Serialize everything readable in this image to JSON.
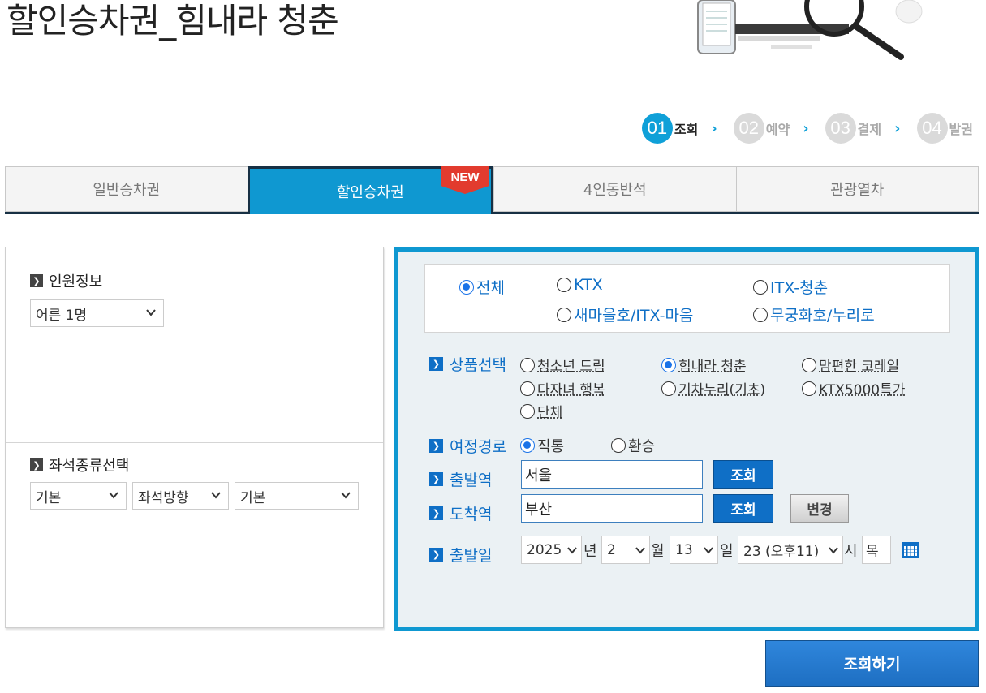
{
  "page": {
    "title": "할인승차권_힘내라 청춘"
  },
  "steps": [
    {
      "num": "01",
      "label": "조회",
      "active": true
    },
    {
      "num": "02",
      "label": "예약",
      "active": false
    },
    {
      "num": "03",
      "label": "결제",
      "active": false
    },
    {
      "num": "04",
      "label": "발권",
      "active": false
    }
  ],
  "tabs": {
    "general": "일반승차권",
    "discount": "할인승차권",
    "discount_badge": "NEW",
    "four_seat": "4인동반석",
    "tourist": "관광열차"
  },
  "left": {
    "passenger_title": "인원정보",
    "passenger_value": "어른 1명",
    "seat_title": "좌석종류선택",
    "seat_type": "기본",
    "seat_direction": "좌석방향",
    "seat_position": "기본"
  },
  "train_types": {
    "all": "전체",
    "ktx": "KTX",
    "itx_cheongchun": "ITX-청춘",
    "saemaeul": "새마을호/ITX-마음",
    "mugunghwa": "무궁화호/누리로",
    "selected": "전체"
  },
  "product": {
    "label": "상품선택",
    "options": [
      "청소년 드림",
      "힘내라 청춘",
      "맘편한 코레일",
      "다자녀 행복",
      "기차누리(기초)",
      "KTX5000특가",
      "단체"
    ],
    "selected": "힘내라 청춘"
  },
  "route": {
    "label": "여정경로",
    "direct": "직통",
    "transfer": "환승",
    "selected": "직통"
  },
  "departure": {
    "label": "출발역",
    "value": "서울",
    "search_button": "조회"
  },
  "arrival": {
    "label": "도착역",
    "value": "부산",
    "search_button": "조회",
    "swap_button": "변경"
  },
  "date": {
    "label": "출발일",
    "year": "2025",
    "year_unit": "년",
    "month": "2",
    "month_unit": "월",
    "day": "13",
    "day_unit": "일",
    "hour": "23 (오후11)",
    "hour_unit": "시",
    "weekday": "목"
  },
  "search_button": "조회하기",
  "colors": {
    "accent": "#0f98d1",
    "selected_radio": "#1a73e8",
    "label_blue": "#0f6fc6",
    "tab_border": "#173044"
  }
}
